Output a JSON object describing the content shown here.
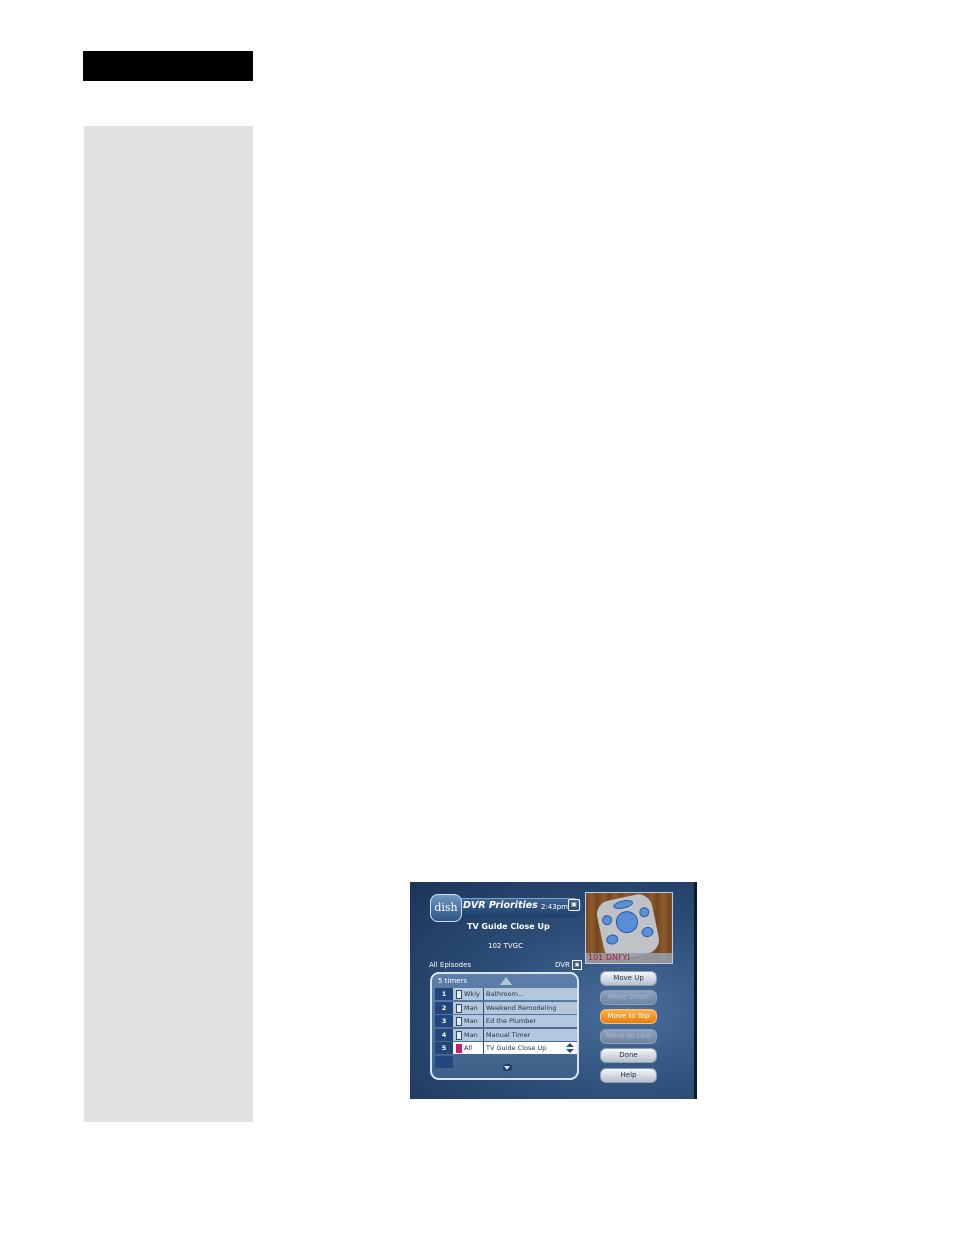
{
  "screen": {
    "title": "DVR Priorities",
    "clock": "2:43pm",
    "logo_text": "dish",
    "program_title": "TV Guide Close Up",
    "channel_info": "102 TVGC",
    "preview_caption": "101 DNFYI",
    "list_label": "All Episodes",
    "dvr_label": "DVR",
    "timer_count": "5 timers",
    "timers": [
      {
        "number": "1",
        "frequency": "Wkly",
        "name": "Bathroom...",
        "selected": false
      },
      {
        "number": "2",
        "frequency": "Man",
        "name": "Weekend Remodeling",
        "selected": false
      },
      {
        "number": "3",
        "frequency": "Man",
        "name": "Ed the Plumber",
        "selected": false
      },
      {
        "number": "4",
        "frequency": "Man",
        "name": "Manual Timer",
        "selected": false
      },
      {
        "number": "5",
        "frequency": "All",
        "name": "TV Guide Close Up",
        "selected": true
      }
    ],
    "buttons": {
      "move_up": "Move Up",
      "move_down": "Move Down",
      "move_to_top": "Move to Top",
      "move_to_last": "Move to Last",
      "done": "Done",
      "help": "Help"
    },
    "colors": {
      "highlight": "#e47e10",
      "background": "#2e4f7a",
      "selected_marker": "#d01a7a"
    }
  }
}
